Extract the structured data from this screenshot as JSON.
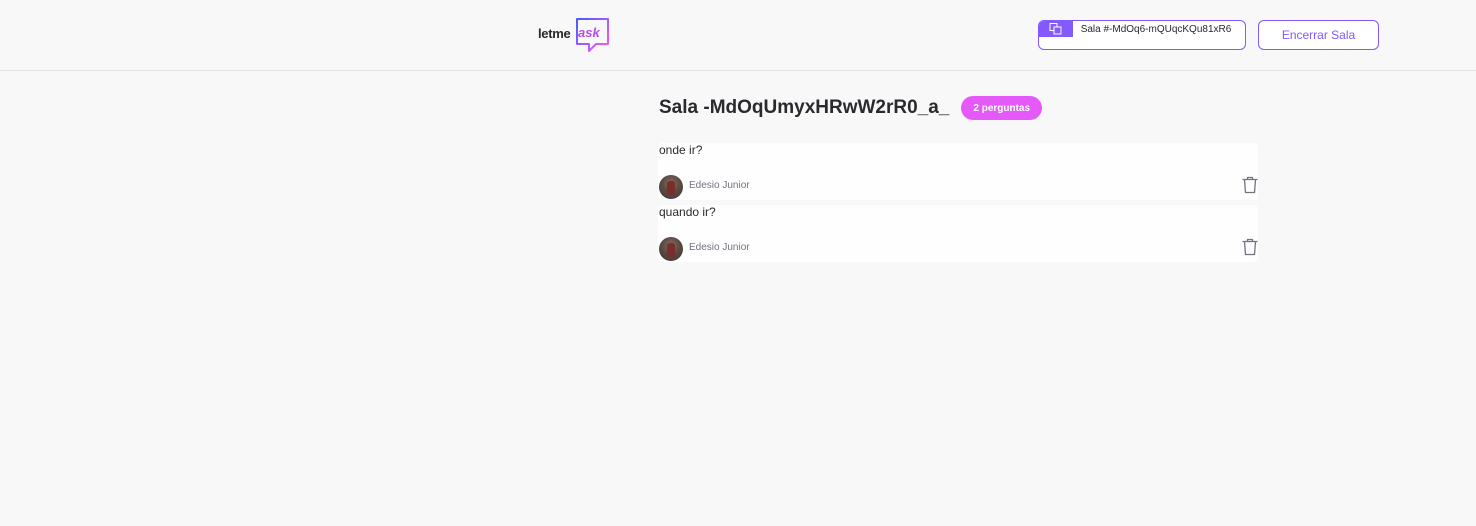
{
  "header": {
    "logo": {
      "text_letme": "letme",
      "text_ask": "ask"
    },
    "room_code": {
      "label": "Sala #-MdOq6-mQUqcKQu81xR6",
      "icon": "copy-icon"
    },
    "close_room_label": "Encerrar Sala"
  },
  "room": {
    "title": "Sala -MdOqUmyxHRwW2rR0_a_",
    "question_count_badge": "2 perguntas"
  },
  "questions": [
    {
      "content": "onde ir?",
      "author": "Edesio Junior",
      "delete_icon": "trash-icon"
    },
    {
      "content": "quando ir?",
      "author": "Edesio Junior",
      "delete_icon": "trash-icon"
    }
  ],
  "colors": {
    "accent": "#835afd",
    "badge": "#e559f9",
    "logo_ask": "#b94ce8",
    "background": "#f8f8f8"
  }
}
